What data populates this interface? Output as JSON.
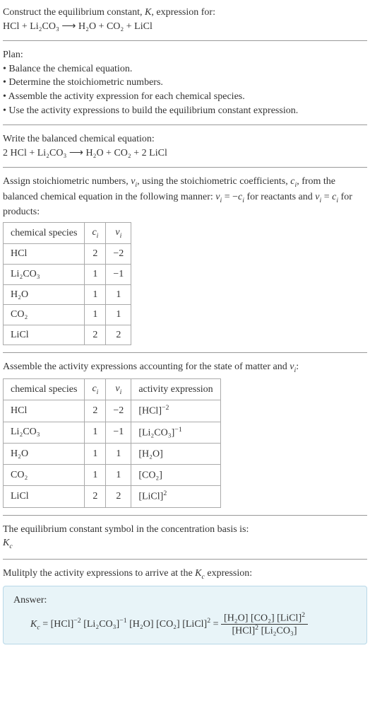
{
  "header": {
    "line1_prefix": "Construct the equilibrium constant, ",
    "line1_K": "K",
    "line1_suffix": ", expression for:",
    "equation_unbalanced": "HCl + Li₂CO₃  ⟶  H₂O + CO₂ + LiCl"
  },
  "plan": {
    "title": "Plan:",
    "bullets": [
      "Balance the chemical equation.",
      "Determine the stoichiometric numbers.",
      "Assemble the activity expression for each chemical species.",
      "Use the activity expressions to build the equilibrium constant expression."
    ]
  },
  "balanced": {
    "title": "Write the balanced chemical equation:",
    "equation_balanced": "2 HCl + Li₂CO₃  ⟶  H₂O + CO₂ + 2 LiCl"
  },
  "assign": {
    "text_parts": {
      "p1": "Assign stoichiometric numbers, ",
      "vi": "ν",
      "vi_sub": "i",
      "p2": ", using the stoichiometric coefficients, ",
      "ci": "c",
      "ci_sub": "i",
      "p3": ", from the balanced chemical equation in the following manner: ",
      "eq1": "ν",
      "eq1_sub": "i",
      "eq1_mid": " = −",
      "eq1_c": "c",
      "eq1_csub": "i",
      "p4": " for reactants and ",
      "eq2": "ν",
      "eq2_sub": "i",
      "eq2_mid": " = ",
      "eq2_c": "c",
      "eq2_csub": "i",
      "p5": " for products:"
    },
    "headers": {
      "species": "chemical species",
      "ci": "c",
      "ci_sub": "i",
      "vi": "ν",
      "vi_sub": "i"
    },
    "rows": [
      {
        "species": "HCl",
        "ci": "2",
        "vi": "−2"
      },
      {
        "species": "Li₂CO₃",
        "ci": "1",
        "vi": "−1"
      },
      {
        "species": "H₂O",
        "ci": "1",
        "vi": "1"
      },
      {
        "species": "CO₂",
        "ci": "1",
        "vi": "1"
      },
      {
        "species": "LiCl",
        "ci": "2",
        "vi": "2"
      }
    ]
  },
  "assemble": {
    "text_p1": "Assemble the activity expressions accounting for the state of matter and ",
    "text_vi": "ν",
    "text_vi_sub": "i",
    "text_p2": ":",
    "headers": {
      "species": "chemical species",
      "ci": "c",
      "ci_sub": "i",
      "vi": "ν",
      "vi_sub": "i",
      "activity": "activity expression"
    },
    "rows": [
      {
        "species": "HCl",
        "ci": "2",
        "vi": "−2",
        "act_base": "[HCl]",
        "act_exp": "−2"
      },
      {
        "species": "Li₂CO₃",
        "ci": "1",
        "vi": "−1",
        "act_base": "[Li₂CO₃]",
        "act_exp": "−1"
      },
      {
        "species": "H₂O",
        "ci": "1",
        "vi": "1",
        "act_base": "[H₂O]",
        "act_exp": ""
      },
      {
        "species": "CO₂",
        "ci": "1",
        "vi": "1",
        "act_base": "[CO₂]",
        "act_exp": ""
      },
      {
        "species": "LiCl",
        "ci": "2",
        "vi": "2",
        "act_base": "[LiCl]",
        "act_exp": "2"
      }
    ]
  },
  "symbol": {
    "text": "The equilibrium constant symbol in the concentration basis is:",
    "Kc": "K",
    "Kc_sub": "c"
  },
  "multiply": {
    "text_p1": "Mulitply the activity expressions to arrive at the ",
    "Kc": "K",
    "Kc_sub": "c",
    "text_p2": " expression:"
  },
  "answer": {
    "label": "Answer:",
    "Kc": "K",
    "Kc_sub": "c",
    "eq": " = ",
    "t1": "[HCl]",
    "t1_exp": "−2",
    "t2": " [Li₂CO₃]",
    "t2_exp": "−1",
    "t3": " [H₂O] [CO₂] [LiCl]",
    "t3_exp": "2",
    "eq2": " = ",
    "num": "[H₂O] [CO₂] [LiCl]",
    "num_exp": "2",
    "den1": "[HCl]",
    "den1_exp": "2",
    "den2": " [Li₂CO₃]"
  }
}
